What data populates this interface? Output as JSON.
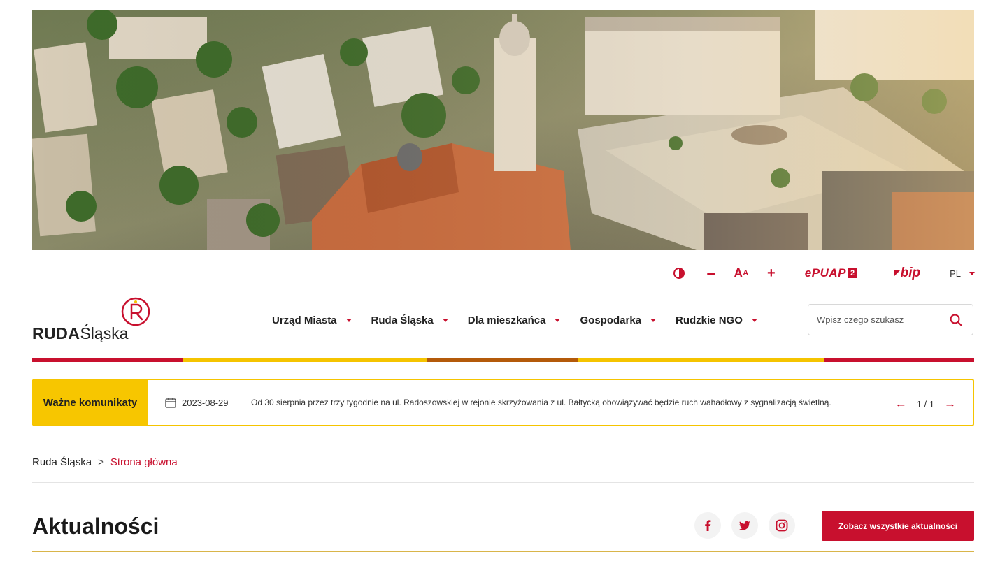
{
  "hero": {
    "alt": "Ruda Śląska aerial view"
  },
  "utility": {
    "contrast_icon": "contrast-icon",
    "font_minus": "–",
    "font_size_big": "A",
    "font_size_small": "A",
    "font_plus": "+",
    "epuap_label": "ePUAP",
    "epuap_badge": "2",
    "bip_label": "bip",
    "language": "PL"
  },
  "logo": {
    "bold": "RUDA",
    "light": "Śląska"
  },
  "nav": {
    "items": [
      {
        "label": "Urząd Miasta"
      },
      {
        "label": "Ruda Śląska"
      },
      {
        "label": "Dla mieszkańca"
      },
      {
        "label": "Gospodarka"
      },
      {
        "label": "Rudzkie NGO"
      }
    ]
  },
  "search": {
    "placeholder": "Wpisz czego szukasz"
  },
  "stripe_colors": [
    "#c8102e",
    "#f5c400",
    "#b45a0a",
    "#f5c400",
    "#c8102e"
  ],
  "announcement": {
    "label": "Ważne komunikaty",
    "date": "2023-08-29",
    "text": "Od 30 sierpnia przez trzy tygodnie na ul. Radoszowskiej w rejonie skrzyżowania z ul. Bałtycką obowiązywać będzie ruch wahadłowy z sygnalizacją świetlną.",
    "prev": "←",
    "count": "1 / 1",
    "next": "→"
  },
  "breadcrumb": {
    "home": "Ruda Śląska",
    "separator": ">",
    "current": "Strona główna"
  },
  "news": {
    "title": "Aktualności",
    "all_button": "Zobacz wszystkie aktualności",
    "socials": [
      "facebook-icon",
      "twitter-icon",
      "instagram-icon"
    ]
  },
  "colors": {
    "accent": "#c8102e",
    "yellow": "#f5c400",
    "brown": "#b45a0a"
  }
}
